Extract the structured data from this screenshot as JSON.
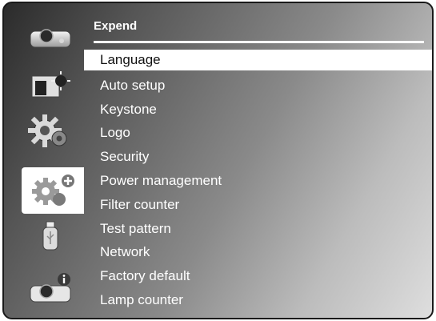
{
  "menu": {
    "title": "Expend",
    "items": [
      {
        "label": "Language",
        "selected": true
      },
      {
        "label": "Auto setup"
      },
      {
        "label": "Keystone"
      },
      {
        "label": "Logo"
      },
      {
        "label": "Security"
      },
      {
        "label": "Power management"
      },
      {
        "label": "Filter counter"
      },
      {
        "label": "Test pattern"
      },
      {
        "label": "Network"
      },
      {
        "label": "Factory default"
      },
      {
        "label": "Lamp counter"
      }
    ]
  },
  "sidebar": {
    "icons": [
      {
        "name": "projector-icon"
      },
      {
        "name": "picture-adjust-icon"
      },
      {
        "name": "settings-gear-icon"
      },
      {
        "name": "expand-gear-icon",
        "active": true
      },
      {
        "name": "usb-memory-icon"
      },
      {
        "name": "projector-info-icon"
      }
    ]
  },
  "colors": {
    "highlight": "#ffffff",
    "text": "#ffffff",
    "selected_text": "#111111",
    "frame_border": "#1a1a1a"
  }
}
